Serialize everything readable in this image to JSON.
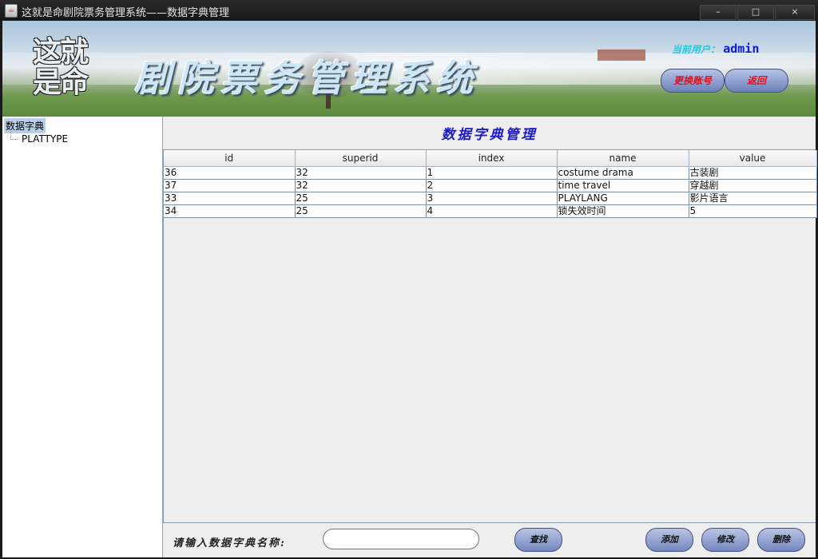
{
  "window": {
    "title": "这就是命剧院票务管理系统——数据字典管理",
    "buttons": {
      "minimize": "–",
      "maximize": "□",
      "close": "×"
    }
  },
  "banner": {
    "logo_small": "这就是命",
    "logo_big": "剧院票务管理系统",
    "user_label": "当前用户：",
    "username": "admin",
    "switch_account": "更换账号",
    "back": "返回"
  },
  "tree": {
    "root": "数据字典",
    "children": [
      "PLATTYPE"
    ]
  },
  "main": {
    "title": "数据字典管理",
    "table": {
      "columns": [
        "id",
        "superid",
        "index",
        "name",
        "value"
      ],
      "rows": [
        [
          "36",
          "32",
          "1",
          "costume drama",
          "古装剧"
        ],
        [
          "37",
          "32",
          "2",
          "time travel",
          "穿越剧"
        ],
        [
          "33",
          "25",
          "3",
          "PLAYLANG",
          "影片语言"
        ],
        [
          "34",
          "25",
          "4",
          "锁失效时间",
          "5"
        ]
      ]
    },
    "search": {
      "label": "请输入数据字典名称:",
      "value": "",
      "placeholder": ""
    },
    "buttons": {
      "find": "查找",
      "add": "添加",
      "edit": "修改",
      "delete": "删除"
    }
  }
}
